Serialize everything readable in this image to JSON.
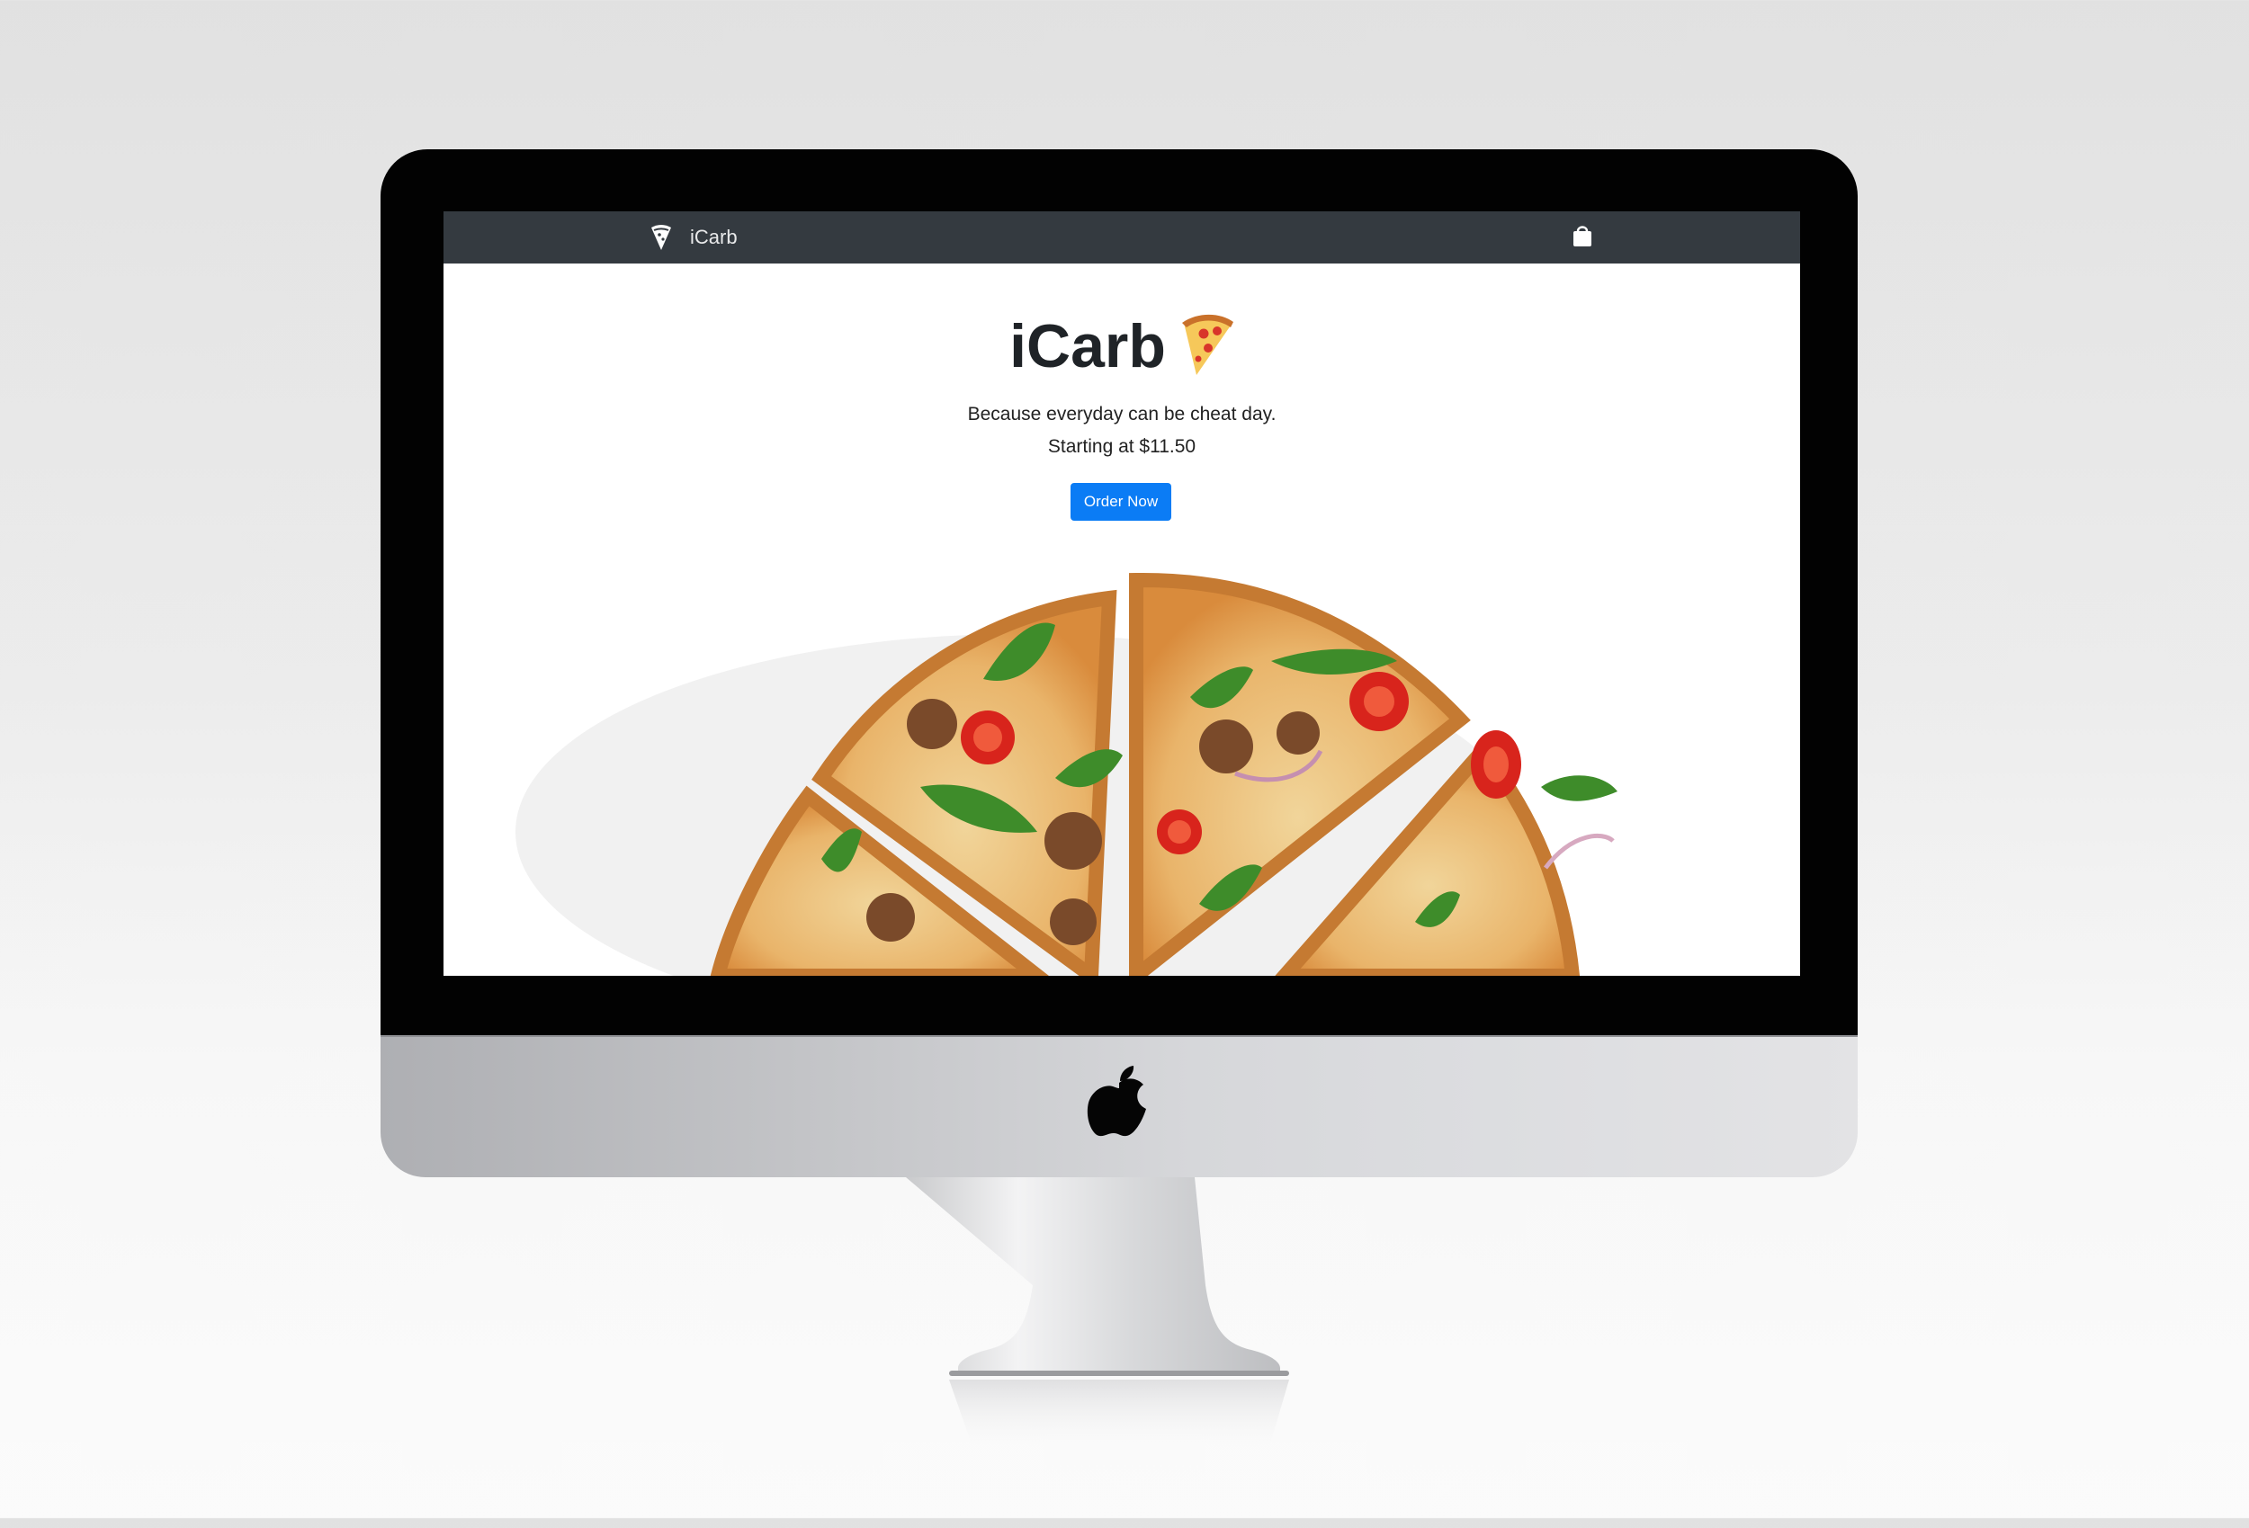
{
  "navbar": {
    "brand_label": "iCarb",
    "brand_icon": "pizza-slice-icon",
    "cart_icon": "shopping-bag-icon"
  },
  "hero": {
    "title": "iCarb",
    "title_emoji": "pizza-emoji",
    "tagline": "Because everyday can be cheat day.",
    "price_text": "Starting at $11.50",
    "cta_label": "Order Now"
  },
  "colors": {
    "navbar_bg": "#343a40",
    "cta_bg": "#0b7cf5",
    "monitor_bezel": "#020202"
  }
}
